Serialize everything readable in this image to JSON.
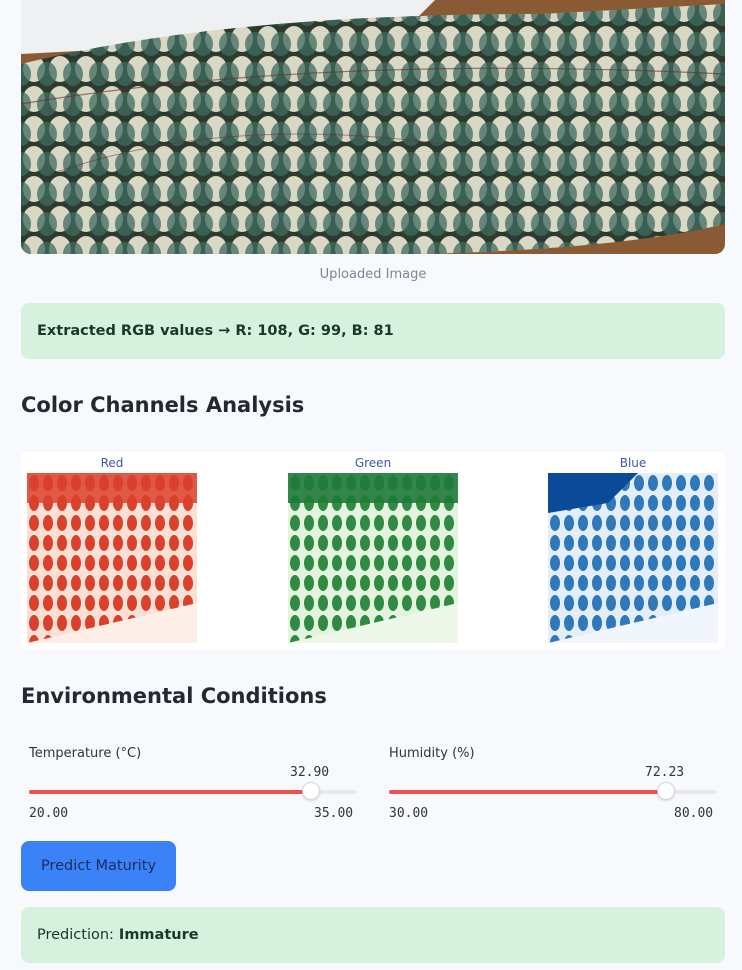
{
  "image": {
    "caption": "Uploaded Image"
  },
  "extracted": {
    "text": "Extracted RGB values → R: 108, G: 99, B: 81"
  },
  "channels": {
    "heading": "Color Channels Analysis",
    "items": [
      {
        "title": "Red",
        "color": "#d9412c"
      },
      {
        "title": "Green",
        "color": "#2f8b42"
      },
      {
        "title": "Blue",
        "color": "#2f78ba"
      }
    ]
  },
  "environment": {
    "heading": "Environmental Conditions",
    "temperature": {
      "label": "Temperature (°C)",
      "value": "32.90",
      "min": "20.00",
      "max": "35.00",
      "fraction": 0.86
    },
    "humidity": {
      "label": "Humidity (%)",
      "value": "72.23",
      "min": "30.00",
      "max": "80.00",
      "fraction": 0.845
    }
  },
  "actions": {
    "predict_label": "Predict Maturity"
  },
  "prediction": {
    "prefix": "Prediction:",
    "value": "Immature"
  },
  "colors": {
    "slider_accent": "#e55451",
    "button": "#3b82f6",
    "success_bg": "#d7f1df"
  }
}
